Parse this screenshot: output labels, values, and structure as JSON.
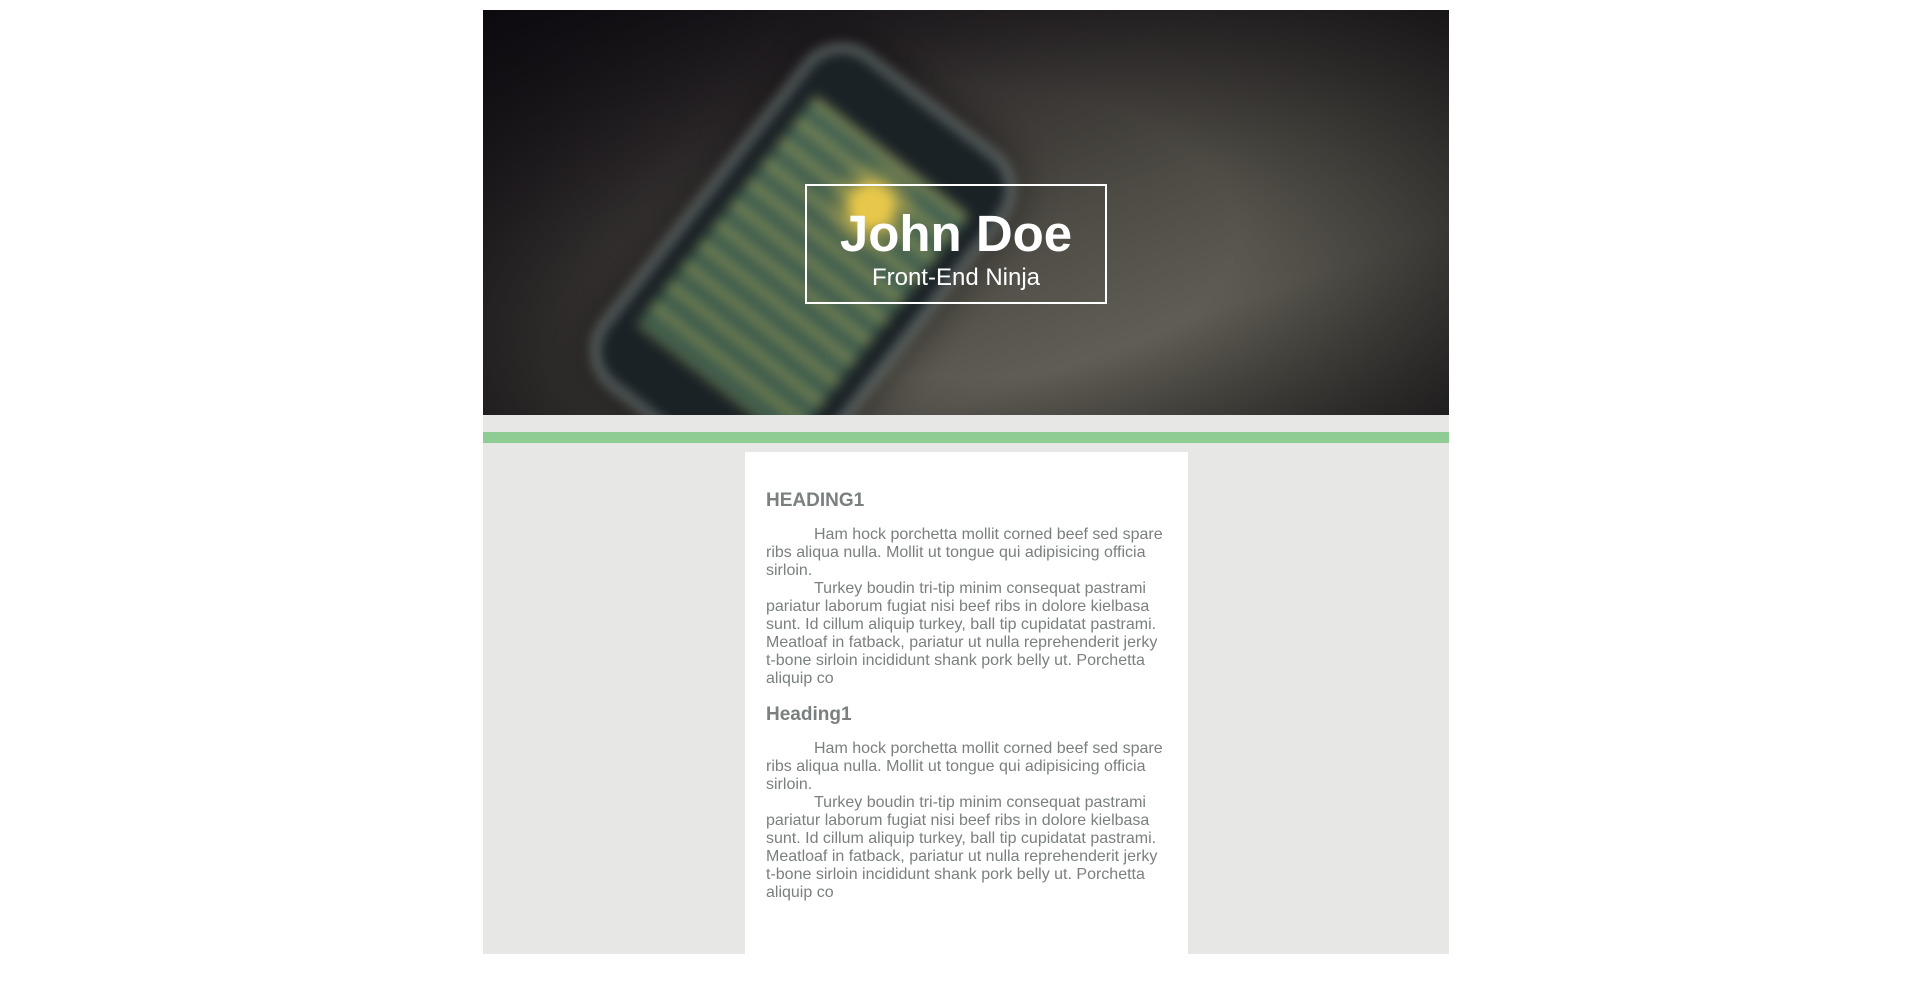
{
  "header": {
    "name": "John Doe",
    "role": "Front-End Ninja"
  },
  "colors": {
    "page_background": "#e7e7e5",
    "accent_bar": "#8fcc94",
    "text": "#7a7f7f",
    "title_text": "#ffffff"
  },
  "sections": [
    {
      "heading": "HEADING1",
      "paragraphs": [
        "Ham hock porchetta mollit corned beef sed spare ribs aliqua nulla. Mollit ut tongue qui adipisicing officia sirloin.",
        "Turkey boudin tri-tip minim consequat pastrami pariatur laborum fugiat nisi beef ribs in dolore kielbasa sunt. Id cillum aliquip turkey, ball tip cupidatat pastrami. Meatloaf in fatback, pariatur ut nulla reprehenderit jerky t-bone sirloin incididunt shank pork belly ut. Porchetta aliquip co"
      ]
    },
    {
      "heading": "Heading1",
      "paragraphs": [
        "Ham hock porchetta mollit corned beef sed spare ribs aliqua nulla. Mollit ut tongue qui adipisicing officia sirloin.",
        "Turkey boudin tri-tip minim consequat pastrami pariatur laborum fugiat nisi beef ribs in dolore kielbasa sunt. Id cillum aliquip turkey, ball tip cupidatat pastrami. Meatloaf in fatback, pariatur ut nulla reprehenderit jerky t-bone sirloin incididunt shank pork belly ut. Porchetta aliquip co"
      ]
    }
  ]
}
